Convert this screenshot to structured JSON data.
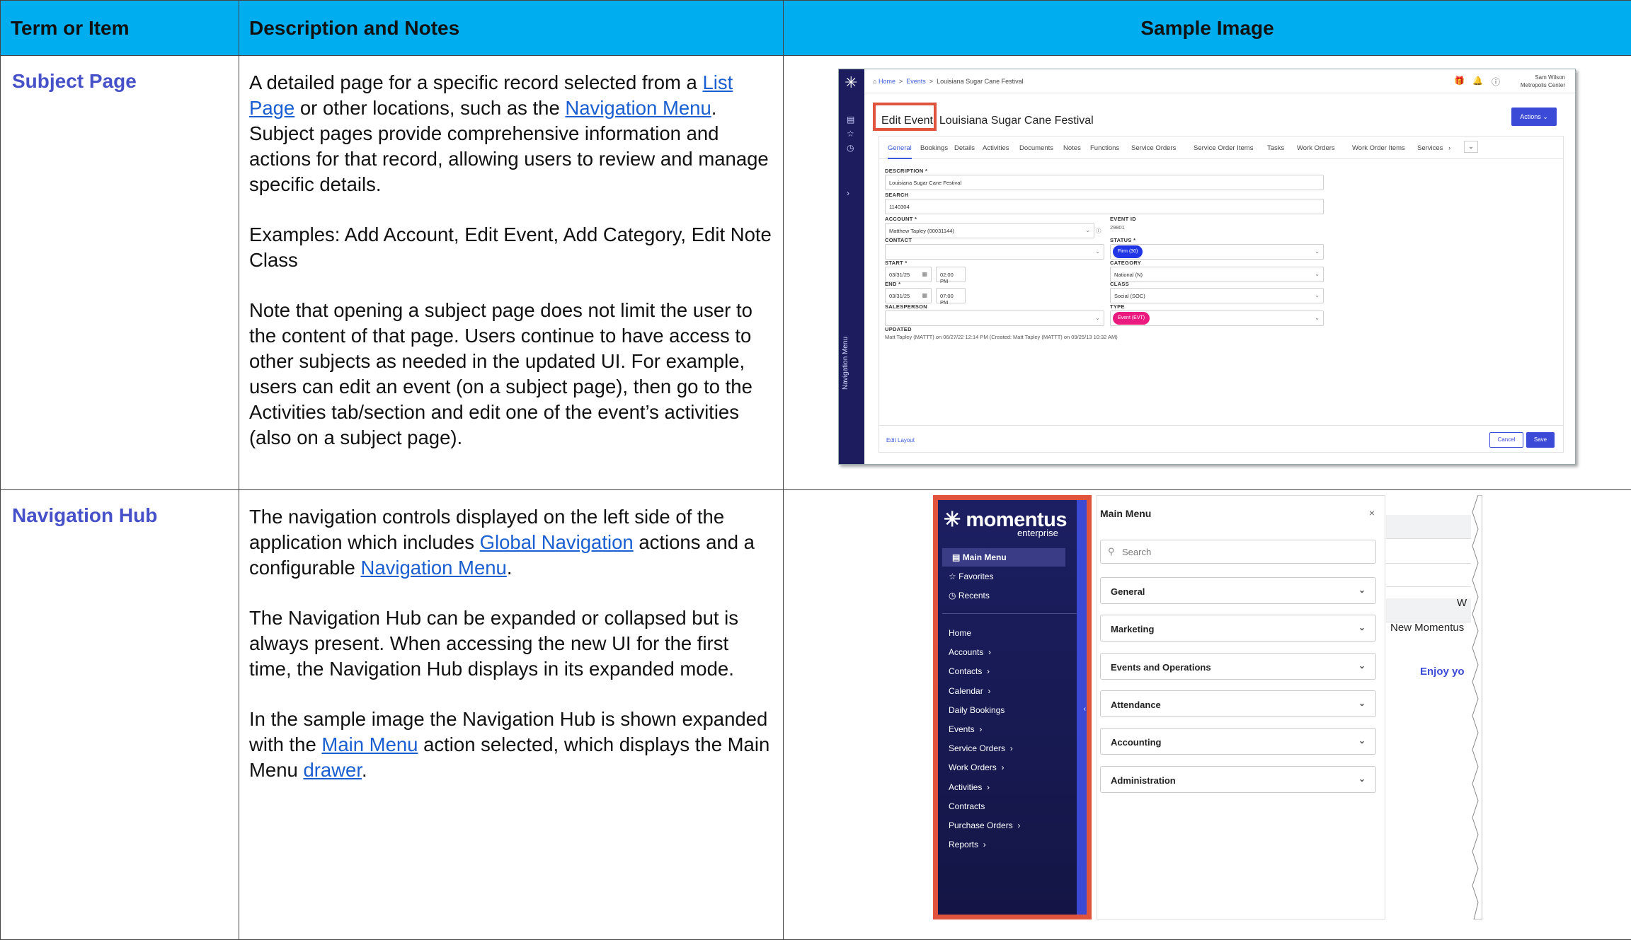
{
  "headers": {
    "term": "Term or Item",
    "description": "Description and Notes",
    "sample": "Sample Image"
  },
  "rows": [
    {
      "term": "Subject Page",
      "para1": {
        "t1": "A detailed page for a specific record selected from a ",
        "link1": "List Page",
        "t2": " or other locations, such as the ",
        "link2": "Navigation Menu",
        "t3": ". Subject pages provide comprehensive information and actions for that record, allowing users to review and manage specific details."
      },
      "para2": "Examples:  Add Account, Edit Event, Add Category, Edit Note Class",
      "para3": "Note that opening a subject page does not limit the user to the content of that page. Users continue to have access to other subjects as needed in the updated UI. For example, users can edit an event (on a subject page), then go to the Activities tab/section and edit one of the event’s activities (also on a subject page)."
    },
    {
      "term": "Navigation Hub",
      "para1": {
        "t1": "The navigation controls displayed on the left side of the application which includes ",
        "link1": "Global Navigation",
        "t2": " actions and a configurable ",
        "link2": "Navigation Menu",
        "t3": "."
      },
      "para2": "The Navigation Hub can be expanded or collapsed but is always present. When accessing the new UI for the first time, the Navigation Hub displays in its expanded mode.",
      "para3": {
        "t1": "In the sample image the Navigation Hub is shown expanded with the ",
        "link1": "Main Menu",
        "t2": " action selected, which displays the Main Menu ",
        "link2": "drawer",
        "t3": "."
      }
    }
  ],
  "sample1": {
    "rail_label": "Navigation Menu",
    "breadcrumb": [
      "Home",
      "Events",
      "Louisiana Sugar Cane Festival"
    ],
    "user_name": "Sam Wilson",
    "user_org": "Metropolis Center",
    "edit_label": "Edit Event",
    "record_title": "Louisiana Sugar Cane Festival",
    "actions": "Actions",
    "tabs": [
      "General",
      "Bookings",
      "Details",
      "Activities",
      "Documents",
      "Notes",
      "Functions",
      "Service Orders",
      "Service Order Items",
      "Tasks",
      "Work Orders",
      "Work Order Items",
      "Services"
    ],
    "labels": {
      "description": "DESCRIPTION *",
      "search": "SEARCH",
      "account": "ACCOUNT *",
      "event_id": "EVENT ID",
      "contact": "CONTACT",
      "status": "STATUS *",
      "start": "START *",
      "category": "CATEGORY",
      "end": "END *",
      "class": "CLASS",
      "salesperson": "SALESPERSON",
      "type": "TYPE",
      "updated": "UPDATED"
    },
    "values": {
      "description": "Louisiana Sugar Cane Festival",
      "search": "1140304",
      "account": "Matthew Tapley (00031144)",
      "event_id": "29801",
      "status": "Firm (30)",
      "start_date": "03/31/25",
      "start_time": "02:00 PM",
      "category": "National (N)",
      "end_date": "03/31/25",
      "end_time": "07:00 PM",
      "class": "Social (SOC)",
      "type": "Event (EVT)",
      "updated": "Matt Tapley (MATTT) on 06/27/22 12:14 PM (Created: Matt Tapley (MATTT) on 09/25/13 10:32 AM)"
    },
    "colors": {
      "status": "#1f35e6",
      "type": "#ea1a7f",
      "accent": "#3b4bd8",
      "highlight": "#e0533d"
    },
    "edit_layout": "Edit Layout",
    "cancel": "Cancel",
    "save": "Save"
  },
  "sample2": {
    "logo": "momentus",
    "logo_sub": "enterprise",
    "main_menu": "Main Menu",
    "favorites": "Favorites",
    "recents": "Recents",
    "nav_items": [
      "Home",
      "Accounts",
      "Contacts",
      "Calendar",
      "Daily Bookings",
      "Events",
      "Service Orders",
      "Work Orders",
      "Activities",
      "Contracts",
      "Purchase Orders",
      "Reports"
    ],
    "nav_has_chevron": [
      false,
      true,
      true,
      true,
      false,
      true,
      true,
      true,
      true,
      false,
      true,
      true
    ],
    "drawer_title": "Main Menu",
    "search_placeholder": "Search",
    "groups": [
      "General",
      "Marketing",
      "Events and Operations",
      "Attendance",
      "Accounting",
      "Administration"
    ],
    "behind_text": {
      "w": "W",
      "new": "New Momentus",
      "enjoy": "Enjoy yo"
    }
  }
}
